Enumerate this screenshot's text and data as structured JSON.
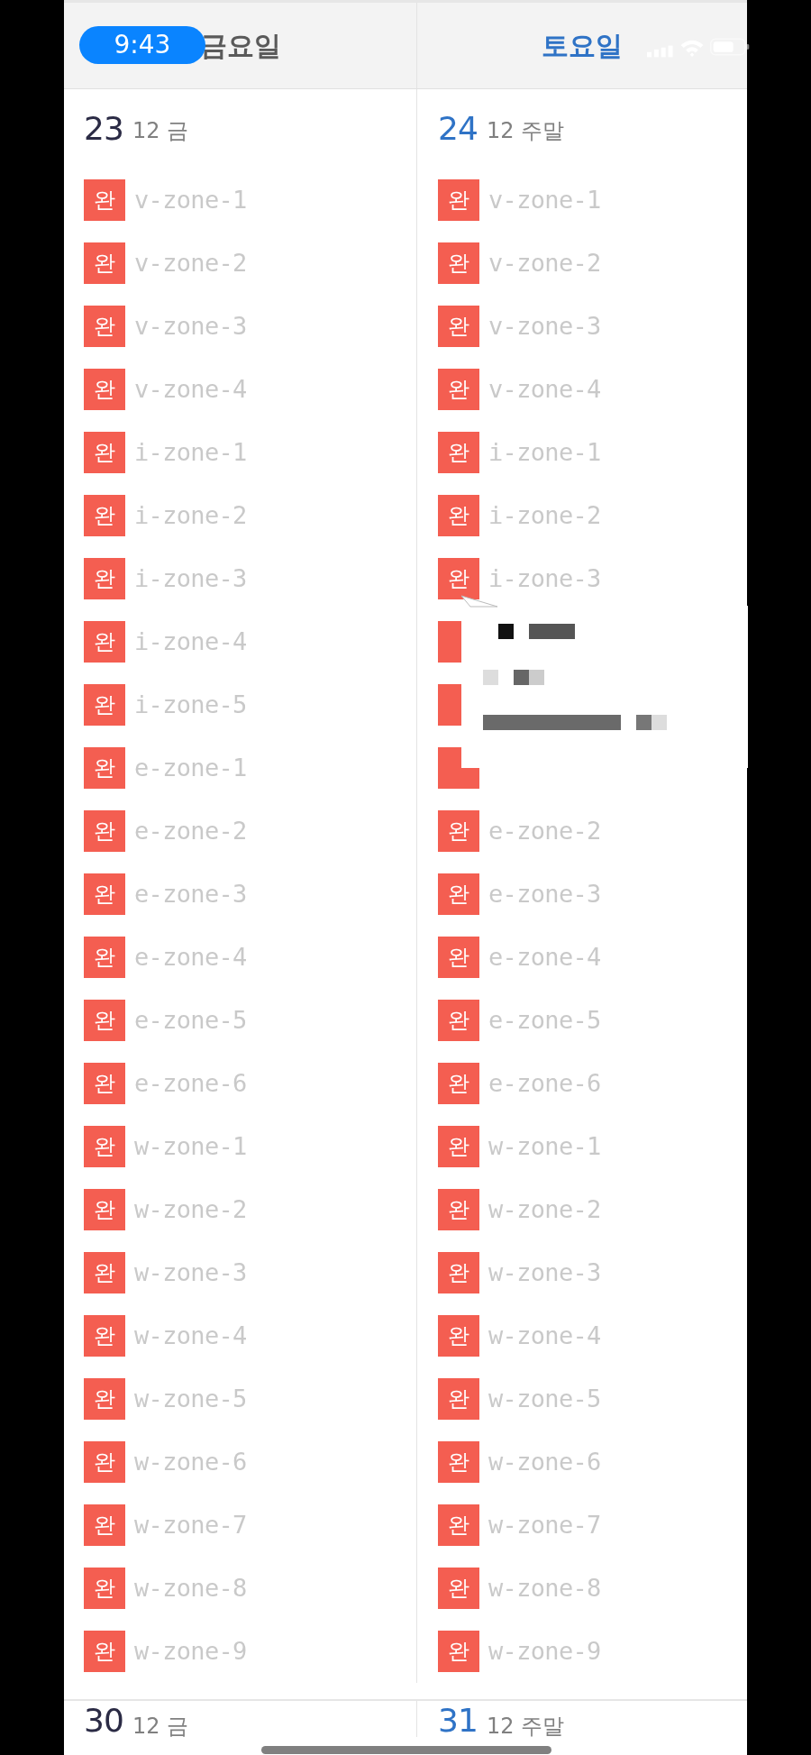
{
  "status_bar": {
    "time": "9:43"
  },
  "header": [
    {
      "label": "금요일",
      "weekend": false
    },
    {
      "label": "토요일",
      "weekend": true
    }
  ],
  "weeks": [
    {
      "days": [
        {
          "day": "23",
          "sub": "12 금",
          "weekend": false,
          "items": [
            {
              "badge": "완",
              "name": "v-zone-1"
            },
            {
              "badge": "완",
              "name": "v-zone-2"
            },
            {
              "badge": "완",
              "name": "v-zone-3"
            },
            {
              "badge": "완",
              "name": "v-zone-4"
            },
            {
              "badge": "완",
              "name": "i-zone-1"
            },
            {
              "badge": "완",
              "name": "i-zone-2"
            },
            {
              "badge": "완",
              "name": "i-zone-3"
            },
            {
              "badge": "완",
              "name": "i-zone-4"
            },
            {
              "badge": "완",
              "name": "i-zone-5"
            },
            {
              "badge": "완",
              "name": "e-zone-1"
            },
            {
              "badge": "완",
              "name": "e-zone-2"
            },
            {
              "badge": "완",
              "name": "e-zone-3"
            },
            {
              "badge": "완",
              "name": "e-zone-4"
            },
            {
              "badge": "완",
              "name": "e-zone-5"
            },
            {
              "badge": "완",
              "name": "e-zone-6"
            },
            {
              "badge": "완",
              "name": "w-zone-1"
            },
            {
              "badge": "완",
              "name": "w-zone-2"
            },
            {
              "badge": "완",
              "name": "w-zone-3"
            },
            {
              "badge": "완",
              "name": "w-zone-4"
            },
            {
              "badge": "완",
              "name": "w-zone-5"
            },
            {
              "badge": "완",
              "name": "w-zone-6"
            },
            {
              "badge": "완",
              "name": "w-zone-7"
            },
            {
              "badge": "완",
              "name": "w-zone-8"
            },
            {
              "badge": "완",
              "name": "w-zone-9"
            }
          ]
        },
        {
          "day": "24",
          "sub": "12 주말",
          "weekend": true,
          "items": [
            {
              "badge": "완",
              "name": "v-zone-1"
            },
            {
              "badge": "완",
              "name": "v-zone-2"
            },
            {
              "badge": "완",
              "name": "v-zone-3"
            },
            {
              "badge": "완",
              "name": "v-zone-4"
            },
            {
              "badge": "완",
              "name": "i-zone-1"
            },
            {
              "badge": "완",
              "name": "i-zone-2"
            },
            {
              "badge": "완",
              "name": "i-zone-3"
            },
            {
              "covered": true
            },
            {
              "covered": true
            },
            {
              "covered": true
            },
            {
              "badge": "완",
              "name": "e-zone-2"
            },
            {
              "badge": "완",
              "name": "e-zone-3"
            },
            {
              "badge": "완",
              "name": "e-zone-4"
            },
            {
              "badge": "완",
              "name": "e-zone-5"
            },
            {
              "badge": "완",
              "name": "e-zone-6"
            },
            {
              "badge": "완",
              "name": "w-zone-1"
            },
            {
              "badge": "완",
              "name": "w-zone-2"
            },
            {
              "badge": "완",
              "name": "w-zone-3"
            },
            {
              "badge": "완",
              "name": "w-zone-4"
            },
            {
              "badge": "완",
              "name": "w-zone-5"
            },
            {
              "badge": "완",
              "name": "w-zone-6"
            },
            {
              "badge": "완",
              "name": "w-zone-7"
            },
            {
              "badge": "완",
              "name": "w-zone-8"
            },
            {
              "badge": "완",
              "name": "w-zone-9"
            }
          ]
        }
      ]
    },
    {
      "days": [
        {
          "day": "30",
          "sub": "12 금",
          "weekend": false
        },
        {
          "day": "31",
          "sub": "12 주말",
          "weekend": true
        }
      ]
    }
  ]
}
